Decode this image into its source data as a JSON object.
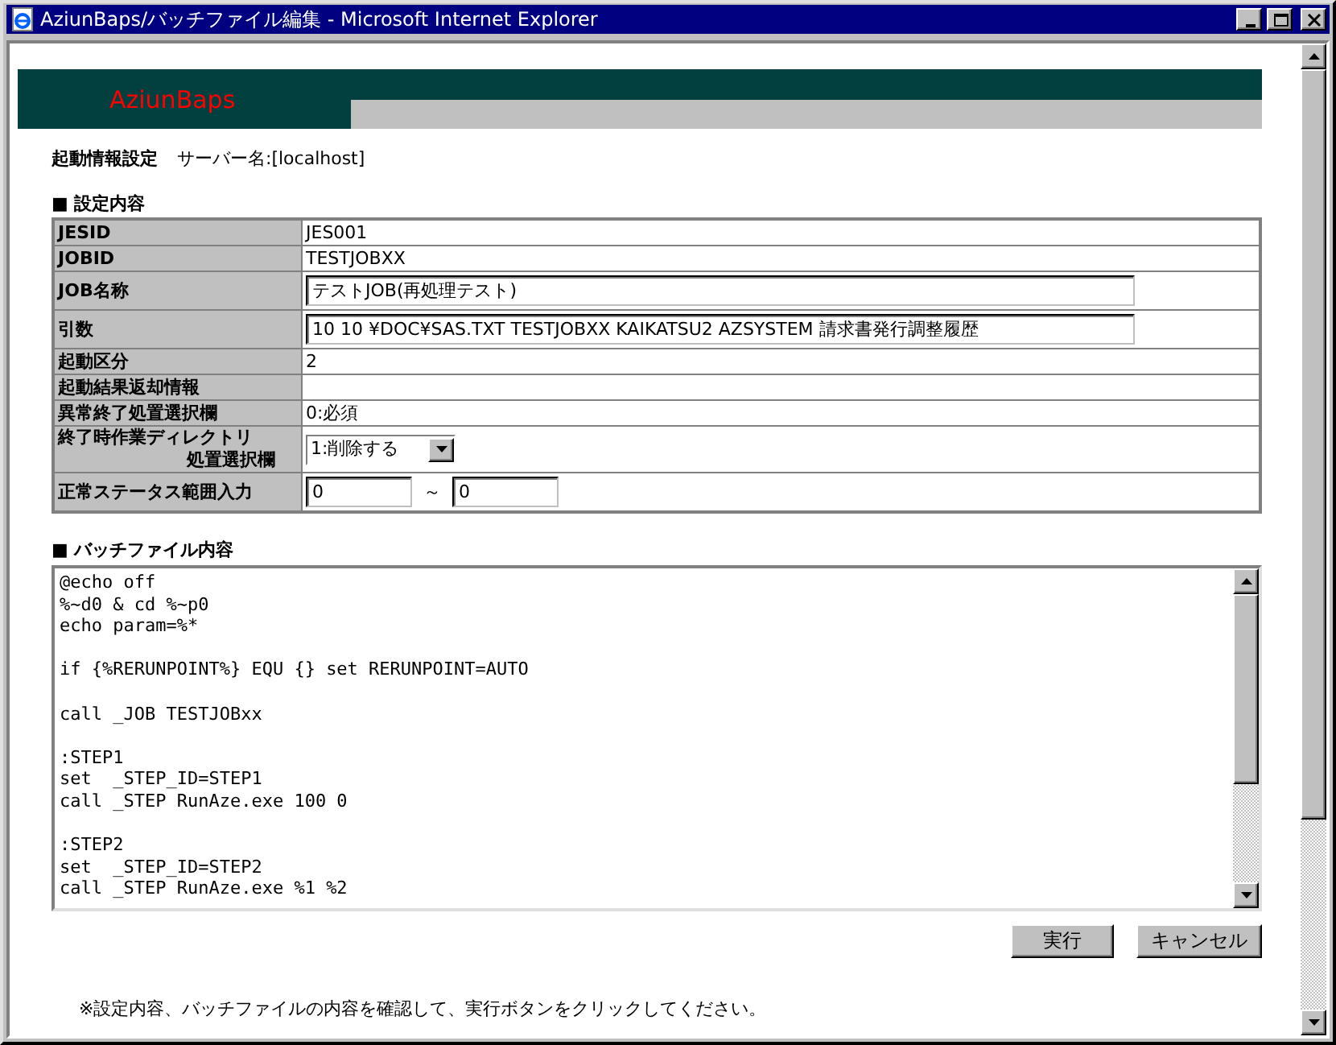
{
  "window": {
    "title": "AziunBaps/バッチファイル編集 - Microsoft Internet Explorer"
  },
  "banner": {
    "logo": "AziunBaps"
  },
  "heading": {
    "title": "起動情報設定",
    "server": "サーバー名:[localhost]"
  },
  "settings": {
    "title": "■ 設定内容",
    "rows": [
      {
        "kind": "text",
        "label": "JESID",
        "value": "JES001"
      },
      {
        "kind": "text",
        "label": "JOBID",
        "value": "TESTJOBXX"
      },
      {
        "kind": "input",
        "label": "JOB名称",
        "value": "テストJOB(再処理テスト)"
      },
      {
        "kind": "input",
        "label": "引数",
        "value": "10 10 ¥DOC¥SAS.TXT TESTJOBXX KAIKATSU2 AZSYSTEM 請求書発行調整履歴"
      },
      {
        "kind": "text",
        "label": "起動区分",
        "value": "2"
      },
      {
        "kind": "text",
        "label": "起動結果返却情報",
        "value": ""
      },
      {
        "kind": "text",
        "label": "異常終了処置選択欄",
        "value": "0:必須"
      },
      {
        "kind": "select",
        "label": "終了時作業ディレクトリ",
        "label_continued": "処置選択欄",
        "value": "1:削除する"
      },
      {
        "kind": "range",
        "label": "正常ステータス範囲入力",
        "from": "0",
        "separator": "～",
        "to": "0"
      }
    ]
  },
  "batch": {
    "title": "■ バッチファイル内容",
    "content": "@echo off\n%~d0 & cd %~p0\necho param=%*\n\nif {%RERUNPOINT%} EQU {} set RERUNPOINT=AUTO\n\ncall _JOB TESTJOBxx\n\n:STEP1\nset  _STEP_ID=STEP1\ncall _STEP RunAze.exe 100 0\n\n:STEP2\nset  _STEP_ID=STEP2\ncall _STEP RunAze.exe %1 %2"
  },
  "buttons": [
    "実行",
    "キャンセル"
  ],
  "note": "※設定内容、バッチファイルの内容を確認して、実行ボタンをクリックしてください。"
}
